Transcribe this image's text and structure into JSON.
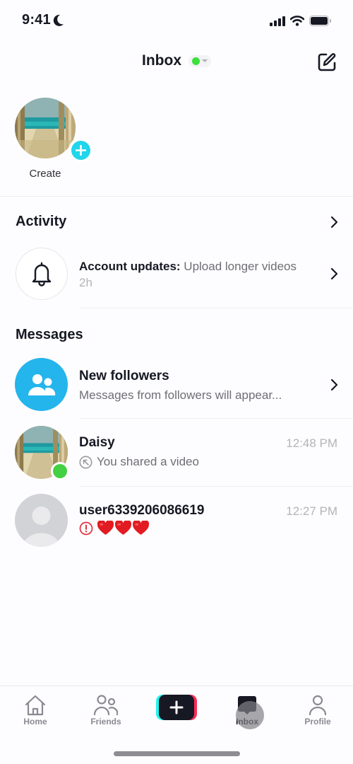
{
  "status_bar": {
    "time": "9:41",
    "icons": [
      "moon-icon",
      "signal-icon",
      "wifi-icon",
      "battery-icon"
    ]
  },
  "header": {
    "title": "Inbox",
    "online_status_color": "#3be03b",
    "compose_icon": "compose-icon"
  },
  "stories": {
    "create_label": "Create"
  },
  "activity": {
    "section_title": "Activity",
    "account_updates": {
      "title": "Account updates:",
      "message": "Upload longer videos",
      "time": "2h",
      "icon": "bell-icon"
    }
  },
  "messages": {
    "section_title": "Messages",
    "items": [
      {
        "title": "New followers",
        "subtitle": "Messages from followers will appear...",
        "icon": "followers-icon",
        "accent": "#23b5ec"
      },
      {
        "title": "Daisy",
        "subtitle": "You shared a video",
        "time": "12:48 PM",
        "online": true,
        "sub_icon": "shared-arrow-icon"
      },
      {
        "title": "user6339206086619",
        "subtitle": "❤️❤️❤️",
        "time": "12:27 PM",
        "sub_icon": "error-icon"
      }
    ]
  },
  "tabbar": {
    "tabs": [
      {
        "label": "Home",
        "icon": "home-icon"
      },
      {
        "label": "Friends",
        "icon": "friends-icon"
      },
      {
        "label": "",
        "icon": "create-plus-icon"
      },
      {
        "label": "Inbox",
        "icon": "inbox-icon",
        "active": true
      },
      {
        "label": "Profile",
        "icon": "profile-icon"
      }
    ],
    "create_symbol": "+"
  }
}
